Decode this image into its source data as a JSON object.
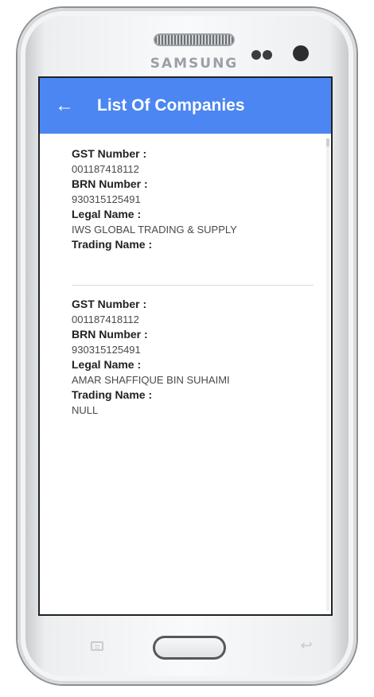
{
  "device": {
    "brand": "SAMSUNG"
  },
  "appbar": {
    "title": "List Of Companies",
    "back_icon": "arrow-left-icon",
    "color": "#4b86f2"
  },
  "labels": {
    "gst": "GST Number :",
    "brn": "BRN Number :",
    "legal": "Legal Name :",
    "trading": "Trading Name :"
  },
  "companies": [
    {
      "gst_number": "001187418112",
      "brn_number": "930315125491",
      "legal_name": "IWS GLOBAL TRADING & SUPPLY",
      "trading_name": ""
    },
    {
      "gst_number": "001187418112",
      "brn_number": "930315125491",
      "legal_name": "AMAR SHAFFIQUE BIN SUHAIMI",
      "trading_name": "NULL"
    }
  ],
  "nav": {
    "menu_icon": "menu-icon",
    "home_icon": "home-button",
    "back_icon": "back-arrow-icon"
  }
}
